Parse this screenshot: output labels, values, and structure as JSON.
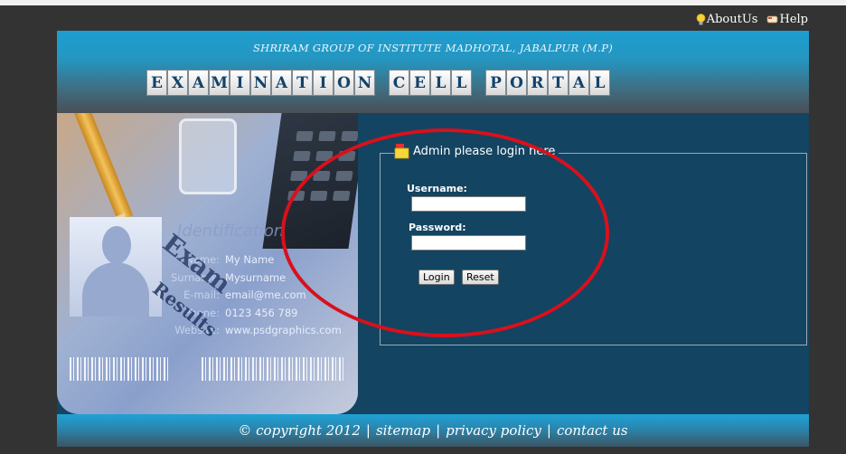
{
  "top_links": [
    {
      "label": "AboutUs",
      "icon": "lightbulb-icon"
    },
    {
      "label": "Help",
      "icon": "help-icon"
    }
  ],
  "header": {
    "institute": "SHRIRAM GROUP OF INSTITUTE MADHOTAL, JABALPUR (M.P)",
    "portal_title": "EXAMINATION CELL PORTAL"
  },
  "id_card": {
    "heading": "Identification",
    "overlay_word_1": "Exam",
    "overlay_word_2": "Results",
    "fields": [
      {
        "label": "Name:",
        "value": "My Name"
      },
      {
        "label": "Surname:",
        "value": "Mysurname"
      },
      {
        "label": "E-mail:",
        "value": "email@me.com"
      },
      {
        "label": "Phone:",
        "value": "0123 456 789"
      },
      {
        "label": "Website:",
        "value": "www.psdgraphics.com"
      }
    ]
  },
  "login": {
    "legend": "Admin please login here",
    "username_label": "Username:",
    "password_label": "Password:",
    "username_value": "",
    "password_value": "",
    "login_button": "Login",
    "reset_button": "Reset"
  },
  "footer": {
    "copyright": "© copyright 2012",
    "links": [
      "sitemap",
      "privacy policy",
      "contact us"
    ],
    "separator": "|"
  },
  "colors": {
    "page_bg": "#333333",
    "main_bg": "#134461",
    "header_accent": "#1e9ed0",
    "highlight_circle": "#d9101d"
  }
}
